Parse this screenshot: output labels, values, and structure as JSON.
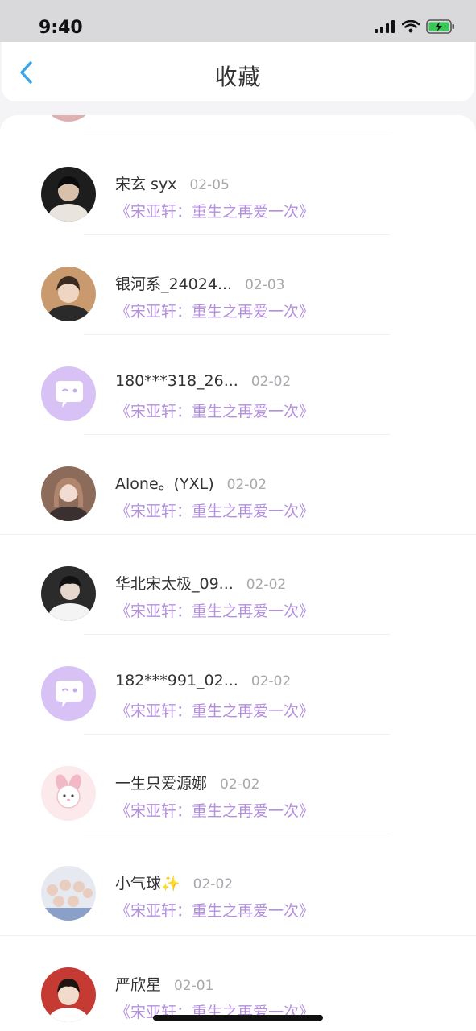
{
  "status": {
    "time": "9:40"
  },
  "header": {
    "title": "收藏"
  },
  "items": [
    {
      "name": "宋玄 syx",
      "date": "02-05",
      "subtitle": "《宋亚轩：重生之再爱一次》"
    },
    {
      "name": "银河系_24024...",
      "date": "02-03",
      "subtitle": "《宋亚轩：重生之再爱一次》"
    },
    {
      "name": "180***318_26...",
      "date": "02-02",
      "subtitle": "《宋亚轩：重生之再爱一次》"
    },
    {
      "name": "Alone。(YXL)",
      "date": "02-02",
      "subtitle": "《宋亚轩：重生之再爱一次》"
    },
    {
      "name": "华北宋太极_09...",
      "date": "02-02",
      "subtitle": "《宋亚轩：重生之再爱一次》"
    },
    {
      "name": "182***991_02...",
      "date": "02-02",
      "subtitle": "《宋亚轩：重生之再爱一次》"
    },
    {
      "name": "一生只爱源娜",
      "date": "02-02",
      "subtitle": "《宋亚轩：重生之再爱一次》"
    },
    {
      "name": "小气球✨",
      "date": "02-02",
      "subtitle": "《宋亚轩：重生之再爱一次》"
    },
    {
      "name": "严欣星",
      "date": "02-01",
      "subtitle": "《宋亚轩：重生之再爱一次》"
    }
  ],
  "colors": {
    "accent_purple": "#b48fe0",
    "back_blue": "#3aa6e8",
    "default_avatar_bg": "#d8c2f5"
  }
}
